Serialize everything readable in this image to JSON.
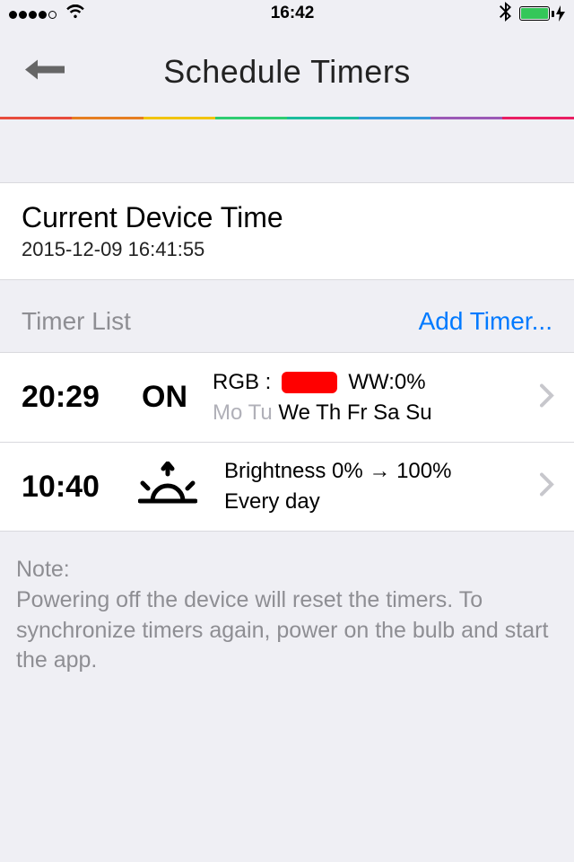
{
  "status": {
    "time": "16:42"
  },
  "nav": {
    "title": "Schedule Timers"
  },
  "currentDevice": {
    "heading": "Current Device Time",
    "value": "2015-12-09 16:41:55"
  },
  "listHeader": {
    "title": "Timer List",
    "addLabel": "Add Timer..."
  },
  "timers": [
    {
      "time": "20:29",
      "state": "ON",
      "rgb_label": "RGB :",
      "rgb_color": "#ff0000",
      "ww_label": "WW:0%",
      "days_dim": "Mo Tu",
      "days_active": " We Th Fr Sa Su"
    },
    {
      "time": "10:40",
      "brightness_line": "Brightness 0% → 100%",
      "schedule_line": "Every day"
    }
  ],
  "note": {
    "heading": "Note:",
    "body": "Powering off the device will reset the timers. To synchronize timers again, power on the bulb and start the app."
  }
}
